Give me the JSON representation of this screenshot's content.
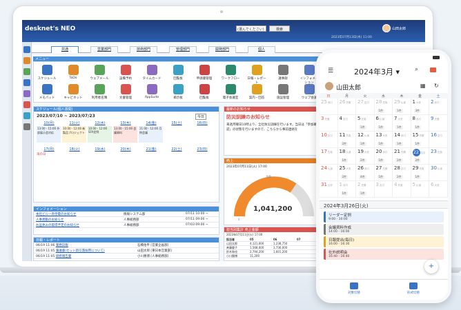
{
  "app": {
    "logo": "desknet's NEO",
    "group_select": "(選んでください)",
    "search_button": "検索",
    "user_name": "山田太郎",
    "datetime": "2023年07月13日(木) 11:00"
  },
  "tabs": [
    "共通",
    "営業部門",
    "技術部門",
    "管理部門",
    "開発部門",
    "個人"
  ],
  "menu": {
    "title": "メニュー",
    "items": [
      "スケジュール",
      "ToDo",
      "ウェブメール",
      "設備予約",
      "タイムカード",
      "回覧板",
      "申請書管理",
      "ワークフロー",
      "日報・レポート",
      "議事録",
      "インフォメーション",
      "メモパッド",
      "キャビネット",
      "利用者名簿",
      "文書管理",
      "AppSuite",
      "掲示板",
      "回覧板",
      "電子会議室",
      "案内・回答",
      "施設管理",
      "ウェブ会議"
    ]
  },
  "schedule": {
    "title": "スケジュール(個人週間)",
    "range": "2023/07/10 ~ 2023/07/23",
    "today_btn": "今日",
    "days": [
      "10(月)",
      "11(火)",
      "12(水)",
      "13(木)",
      "14(金)",
      "15(土)",
      "16(日)"
    ],
    "events_row1": [
      "13:00 - 15:00 外部展示会対応",
      "10:00 - 12:00 新製品プロジェクト",
      "10:00 - 12:00 SFA定例",
      "13:00 - 15:00 会議資料",
      "11:00 - 12:00 月例会議"
    ],
    "events_row2": [
      "17(月)",
      "18(火)",
      "19(水)",
      "20(木)",
      "21(金)",
      "22(土)",
      "23(日)"
    ],
    "holiday": "海の日"
  },
  "notice": {
    "title": "最新のお知らせ",
    "headline": "防災訓練のお知らせ",
    "body": "来週月曜日10時より、全社防災訓練を行います。当日は「参加確認」の状態を行いますので、こちらから事前連絡を",
    "link": "こちら"
  },
  "gauge": {
    "title": "売上",
    "date": "2023年07月11日(火) 17:00",
    "value": "1,041,200",
    "max": "予算",
    "zero": "0"
  },
  "info": {
    "title": "インフォメーション",
    "rows": [
      {
        "t": "本社ビル一斉停電のお知らせ",
        "d": "情報システム部",
        "dt": "07/11 10:00 ~"
      },
      {
        "t": "人事異動のお知らせ",
        "d": "人事総務部",
        "dt": "07/11 09:00 ~"
      },
      {
        "t": "お盆休みの取得予定のお知らせ",
        "d": "人事総務部",
        "dt": "07/03 09:00 ~"
      }
    ]
  },
  "report": {
    "title": "日報・レポート",
    "rows": [
      {
        "dt": "06/19 11:06",
        "t": "業務日報",
        "by": "石橋佑平 [営業企画部]"
      },
      {
        "dt": "06/19 11:05",
        "t": "稟議書(セット新引落採用について)",
        "by": "山田太郎 [東日本営業部]"
      },
      {
        "dt": "06/19 11:05",
        "t": "研修報告書",
        "by": "小川勝博 [人事総務部]"
      }
    ]
  },
  "sales": {
    "title": "担当別集計 売上金額",
    "date": "2023年07月11日(火) 17:00",
    "header": [
      "担当者",
      "05",
      "06",
      "07"
    ],
    "rows": [
      [
        "山田太郎",
        "4,121,000",
        "1,238,750",
        ""
      ],
      [
        "斉藤健子",
        "1,568,000",
        "3,736,000",
        ""
      ],
      [
        "鈴木和也",
        "2,794,200",
        "1,601,200",
        ""
      ],
      [
        "小川勝博",
        "11,200",
        "",
        ""
      ]
    ]
  },
  "phone": {
    "month": "2024年3月",
    "user": "山田太郎",
    "dow": [
      "日",
      "月",
      "火",
      "水",
      "木",
      "金",
      "土"
    ],
    "selected_date": "2024年3月26日(火)",
    "today": "22",
    "weeks": [
      [
        [
          "25",
          "赤口",
          ""
        ],
        [
          "26",
          "先勝",
          ""
        ],
        [
          "27",
          "友引",
          ""
        ],
        [
          "28",
          "先負",
          "1件"
        ],
        [
          "29",
          "仏滅",
          "1件"
        ],
        [
          "1",
          "大安",
          "3件"
        ],
        [
          "2",
          "赤口",
          ""
        ]
      ],
      [
        [
          "3",
          "先勝",
          ""
        ],
        [
          "4",
          "友引",
          ""
        ],
        [
          "5",
          "先負",
          "1件"
        ],
        [
          "6",
          "仏滅",
          "1件"
        ],
        [
          "7",
          "大安",
          "1件"
        ],
        [
          "8",
          "赤口",
          "1件"
        ],
        [
          "9",
          "先勝",
          ""
        ]
      ],
      [
        [
          "10",
          "友引",
          ""
        ],
        [
          "11",
          "先負",
          "2件"
        ],
        [
          "12",
          "仏滅",
          "1件"
        ],
        [
          "13",
          "大安",
          "1件"
        ],
        [
          "14",
          "赤口",
          "1件"
        ],
        [
          "15",
          "先勝",
          "1件"
        ],
        [
          "16",
          "友引",
          ""
        ]
      ],
      [
        [
          "17",
          "先負",
          ""
        ],
        [
          "18",
          "仏滅",
          "1件"
        ],
        [
          "19",
          "大安",
          "2件"
        ],
        [
          "20",
          "赤口",
          "1件"
        ],
        [
          "21",
          "先勝",
          "2件"
        ],
        [
          "22",
          "友引",
          "2件"
        ],
        [
          "23",
          "先負",
          ""
        ]
      ],
      [
        [
          "24",
          "仏滅",
          ""
        ],
        [
          "25",
          "大安",
          "2件"
        ],
        [
          "26",
          "赤口",
          "4件"
        ],
        [
          "27",
          "先勝",
          "1件"
        ],
        [
          "28",
          "友引",
          "2件"
        ],
        [
          "29",
          "先負",
          "1件"
        ],
        [
          "30",
          "仏滅",
          ""
        ]
      ],
      [
        [
          "31",
          "大安",
          ""
        ],
        [
          "1",
          "赤口",
          "1件"
        ],
        [
          "2",
          "先勝",
          "1件"
        ],
        [
          "3",
          "友引",
          ""
        ],
        [
          "4",
          "先負",
          ""
        ],
        [
          "5",
          "仏滅",
          ""
        ],
        [
          "6",
          "大安",
          ""
        ]
      ]
    ],
    "events": [
      {
        "title": "リーダー定例",
        "time": "9:00 - 10:00",
        "color": "#e8f1fb",
        "bar": "#3b73c4"
      },
      {
        "title": "会議資料作成",
        "time": "14:00 - 16:00",
        "color": "#eeeeee",
        "bar": "#777777"
      },
      {
        "title": "日報提出(毎日)",
        "time": "16:00 - 16:30",
        "color": "#fff3d6",
        "bar": "#e0a020"
      },
      {
        "title": "社外説明会",
        "time": "16:40 - 16:40",
        "color": "#fde3e0",
        "bar": "#d9534f"
      }
    ],
    "nav": [
      "対象切替",
      "形式切替"
    ]
  }
}
